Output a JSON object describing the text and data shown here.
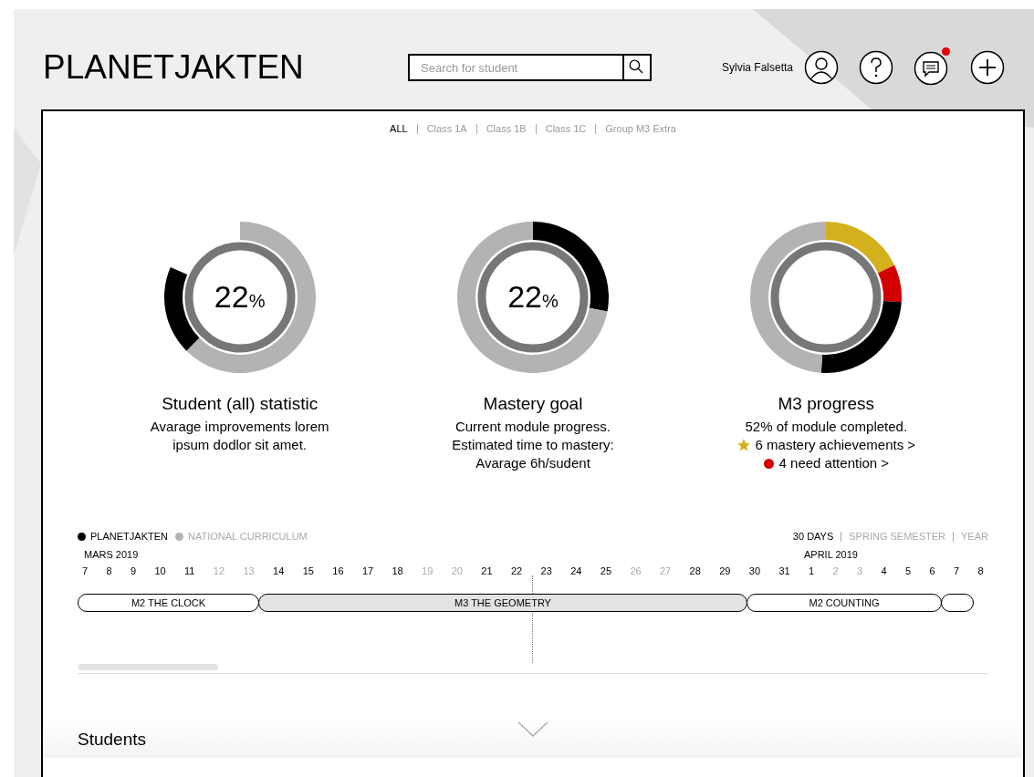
{
  "header": {
    "logo": "PLANETJAKTEN",
    "search": {
      "placeholder": "Search for student"
    },
    "user_name": "Sylvia Falsetta",
    "notifications_unread": true
  },
  "class_filter": [
    {
      "label": "ALL",
      "selected": true
    },
    {
      "label": "Class 1A",
      "selected": false
    },
    {
      "label": "Class 1B",
      "selected": false
    },
    {
      "label": "Class 1C",
      "selected": false
    },
    {
      "label": "Group M3 Extra",
      "selected": false
    }
  ],
  "stats": [
    {
      "value": "22",
      "unit": "%",
      "title": "Student (all) statistic",
      "lines": [
        {
          "kind": "text",
          "text": "Avarage improvements lorem ipsum dodlor sit amet."
        }
      ]
    },
    {
      "value": "22",
      "unit": "%",
      "title": "Mastery goal",
      "lines": [
        {
          "kind": "text",
          "text": "Current module progress."
        },
        {
          "kind": "text",
          "text": "Estimated time to mastery:"
        },
        {
          "kind": "text",
          "text": "Avarage 6h/sudent"
        }
      ]
    },
    {
      "title": "M3 progress",
      "lines": [
        {
          "kind": "text",
          "text": "52% of module completed."
        },
        {
          "kind": "star",
          "text": "6 mastery achievements >"
        },
        {
          "kind": "dot",
          "text": "4 need attention >"
        }
      ]
    }
  ],
  "timeline": {
    "legend": [
      {
        "label": "PLANETJAKTEN",
        "selected": true
      },
      {
        "label": "NATIONAL CURRICULUM",
        "selected": false
      }
    ],
    "ranges": [
      {
        "label": "30 DAYS",
        "selected": true
      },
      {
        "label": "SPRING SEMESTER",
        "selected": false
      },
      {
        "label": "YEAR",
        "selected": false
      }
    ],
    "months": [
      "MARS 2019",
      "APRIL 2019"
    ],
    "days": [
      {
        "d": "7",
        "weekend": false
      },
      {
        "d": "8",
        "weekend": false
      },
      {
        "d": "9",
        "weekend": false
      },
      {
        "d": "10",
        "weekend": false
      },
      {
        "d": "11",
        "weekend": false
      },
      {
        "d": "12",
        "weekend": true
      },
      {
        "d": "13",
        "weekend": true
      },
      {
        "d": "14",
        "weekend": false
      },
      {
        "d": "15",
        "weekend": false
      },
      {
        "d": "16",
        "weekend": false
      },
      {
        "d": "17",
        "weekend": false
      },
      {
        "d": "18",
        "weekend": false
      },
      {
        "d": "19",
        "weekend": true
      },
      {
        "d": "20",
        "weekend": true
      },
      {
        "d": "21",
        "weekend": false
      },
      {
        "d": "22",
        "weekend": false
      },
      {
        "d": "23",
        "weekend": false
      },
      {
        "d": "24",
        "weekend": false
      },
      {
        "d": "25",
        "weekend": false
      },
      {
        "d": "26",
        "weekend": true
      },
      {
        "d": "27",
        "weekend": true
      },
      {
        "d": "28",
        "weekend": false
      },
      {
        "d": "29",
        "weekend": false
      },
      {
        "d": "30",
        "weekend": false
      },
      {
        "d": "31",
        "weekend": false
      },
      {
        "d": "1",
        "weekend": false
      },
      {
        "d": "2",
        "weekend": true
      },
      {
        "d": "3",
        "weekend": true
      },
      {
        "d": "4",
        "weekend": false
      },
      {
        "d": "5",
        "weekend": false
      },
      {
        "d": "6",
        "weekend": false
      },
      {
        "d": "7",
        "weekend": false
      },
      {
        "d": "8",
        "weekend": false
      }
    ],
    "modules": [
      {
        "label": "M2 THE CLOCK",
        "selected": false
      },
      {
        "label": "M3 THE GEOMETRY",
        "selected": true
      },
      {
        "label": "M2 COUNTING",
        "selected": false
      },
      {
        "selected": false
      }
    ]
  },
  "section_title": "Students"
}
